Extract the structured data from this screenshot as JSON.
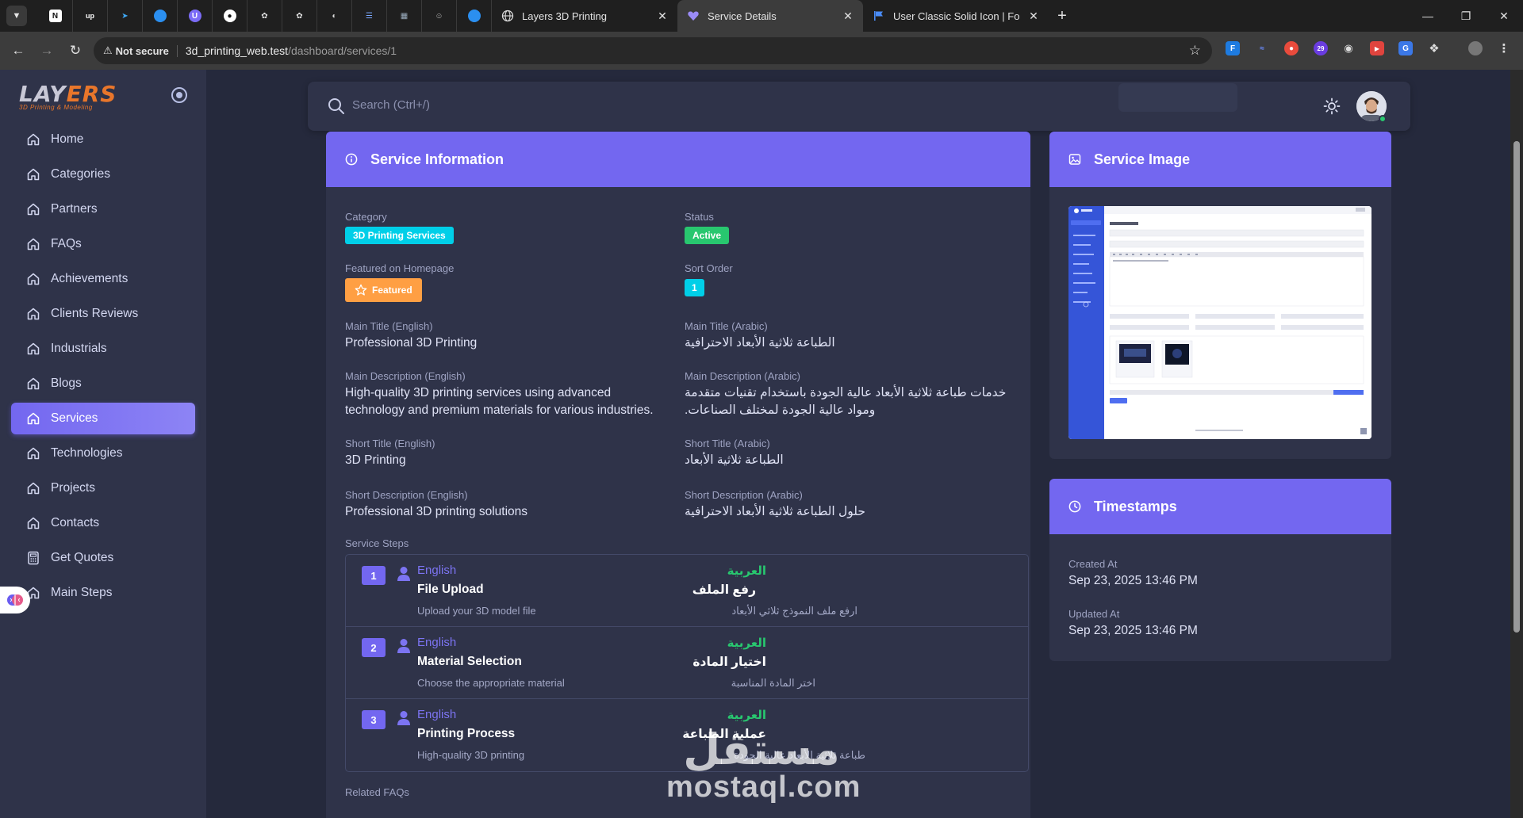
{
  "browser": {
    "tabs": [
      {
        "title": "Layers 3D Printing",
        "active": false
      },
      {
        "title": "Service Details",
        "active": true
      },
      {
        "title": "User Classic Solid Icon | Font Av",
        "active": false
      }
    ],
    "not_secure": "Not secure",
    "url_host": "3d_printing_web.test",
    "url_path": "/dashboard/services/1",
    "ext_badge": "29"
  },
  "sidebar": {
    "logo_word_a": "LAY",
    "logo_word_b": "ERS",
    "logo_tagline": "3D Printing & Modeling",
    "items": [
      {
        "label": "Home",
        "icon": "home-icon"
      },
      {
        "label": "Categories",
        "icon": "home-icon"
      },
      {
        "label": "Partners",
        "icon": "home-icon"
      },
      {
        "label": "FAQs",
        "icon": "home-icon"
      },
      {
        "label": "Achievements",
        "icon": "home-icon"
      },
      {
        "label": "Clients Reviews",
        "icon": "home-icon"
      },
      {
        "label": "Industrials",
        "icon": "home-icon"
      },
      {
        "label": "Blogs",
        "icon": "home-icon"
      },
      {
        "label": "Services",
        "icon": "home-icon",
        "active": true
      },
      {
        "label": "Technologies",
        "icon": "home-icon"
      },
      {
        "label": "Projects",
        "icon": "home-icon"
      },
      {
        "label": "Contacts",
        "icon": "home-icon"
      },
      {
        "label": "Get Quotes",
        "icon": "calculator-icon"
      },
      {
        "label": "Main Steps",
        "icon": "home-icon"
      }
    ]
  },
  "navbar": {
    "search_placeholder": "Search (Ctrl+/)"
  },
  "service_info": {
    "title": "Service Information",
    "category_label": "Category",
    "category_value": "3D Printing Services",
    "status_label": "Status",
    "status_value": "Active",
    "featured_label": "Featured on Homepage",
    "featured_value": "Featured",
    "sort_label": "Sort Order",
    "sort_value": "1",
    "main_title_en_label": "Main Title (English)",
    "main_title_en": "Professional 3D Printing",
    "main_title_ar_label": "Main Title (Arabic)",
    "main_title_ar": "الطباعة ثلاثية الأبعاد الاحترافية",
    "main_desc_en_label": "Main Description (English)",
    "main_desc_en": "High-quality 3D printing services using advanced technology and premium materials for various industries.",
    "main_desc_ar_label": "Main Description (Arabic)",
    "main_desc_ar": "خدمات طباعة ثلاثية الأبعاد عالية الجودة باستخدام تقنيات متقدمة ومواد عالية الجودة لمختلف الصناعات.",
    "short_title_en_label": "Short Title (English)",
    "short_title_en": "3D Printing",
    "short_title_ar_label": "Short Title (Arabic)",
    "short_title_ar": "الطباعة ثلاثية الأبعاد",
    "short_desc_en_label": "Short Description (English)",
    "short_desc_en": "Professional 3D printing solutions",
    "short_desc_ar_label": "Short Description (Arabic)",
    "short_desc_ar": "حلول الطباعة ثلاثية الأبعاد الاحترافية",
    "steps_label": "Service Steps",
    "steps": [
      {
        "num": "1",
        "en_tag": "English",
        "en_title": "File Upload",
        "en_desc": "Upload your 3D model file",
        "ar_tag": "العربية",
        "ar_title": "رفع الملف",
        "ar_desc": "ارفع ملف النموذج ثلاثي الأبعاد"
      },
      {
        "num": "2",
        "en_tag": "English",
        "en_title": "Material Selection",
        "en_desc": "Choose the appropriate material",
        "ar_tag": "العربية",
        "ar_title": "اختيار المادة",
        "ar_desc": "اختر المادة المناسبة"
      },
      {
        "num": "3",
        "en_tag": "English",
        "en_title": "Printing Process",
        "en_desc": "High-quality 3D printing",
        "ar_tag": "العربية",
        "ar_title": "عملية الطباعة",
        "ar_desc": "طباعة ثلاثية الأبعاد عالية الجودة"
      }
    ],
    "related_faqs_label": "Related FAQs"
  },
  "service_image": {
    "title": "Service Image",
    "preview_heading": "Update Post"
  },
  "timestamps": {
    "title": "Timestamps",
    "created_label": "Created At",
    "created_value": "Sep 23, 2025 13:46 PM",
    "updated_label": "Updated At",
    "updated_value": "Sep 23, 2025 13:46 PM"
  },
  "watermark": {
    "arabic": "مستقل",
    "latin": "mostaql.com"
  },
  "colors": {
    "primary": "#7367f0",
    "info": "#00cfe8",
    "success": "#28c76f",
    "warning": "#ff9f43",
    "card_bg": "#2f3349",
    "page_bg": "#25293c"
  }
}
